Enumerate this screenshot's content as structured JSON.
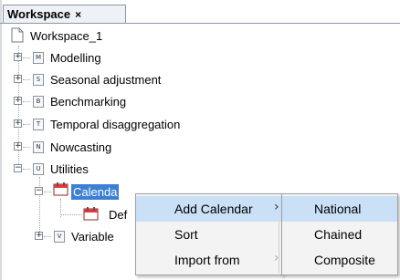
{
  "tab": {
    "label": "Workspace",
    "close": "×"
  },
  "tree": {
    "root": "Workspace_1",
    "items": [
      {
        "label": "Modelling",
        "badge": "M"
      },
      {
        "label": "Seasonal adjustment",
        "badge": "S"
      },
      {
        "label": "Benchmarking",
        "badge": "B"
      },
      {
        "label": "Temporal disaggregation",
        "badge": "T"
      },
      {
        "label": "Nowcasting",
        "badge": "N"
      },
      {
        "label": "Utilities",
        "badge": "U"
      }
    ],
    "calendars": "Calenda",
    "default_calendar": "Def",
    "variables": "Variable",
    "variables_badge": "V",
    "expand_symbol": "+",
    "collapse_symbol": "−"
  },
  "context_menu": {
    "items": [
      {
        "label": "Add Calendar",
        "arrow": "›"
      },
      {
        "label": "Sort"
      },
      {
        "label": "Import from",
        "arrow": "›"
      }
    ]
  },
  "submenu": {
    "items": [
      "National",
      "Chained",
      "Composite"
    ]
  },
  "colors": {
    "selection": "#3c7fd4",
    "menu_highlight": "#c9e0f7",
    "calendar_icon": "#e03a3a"
  }
}
